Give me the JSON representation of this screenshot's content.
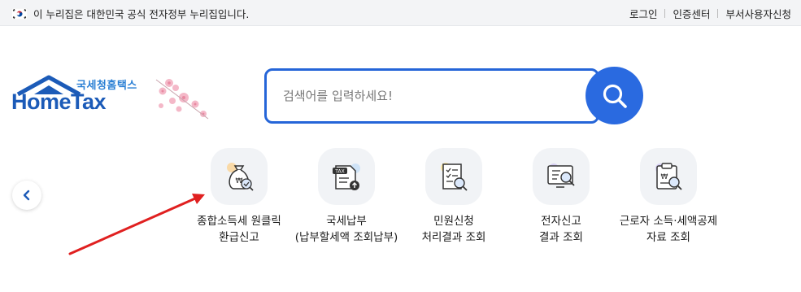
{
  "topbar": {
    "gov_notice": "이 누리집은 대한민국 공식 전자정부 누리집입니다.",
    "links": [
      "로그인",
      "인증센터",
      "부서사용자신청"
    ]
  },
  "logo": {
    "subtitle": "국세청홈택스",
    "title": "HomeTax"
  },
  "search": {
    "placeholder": "검색어를 입력하세요!"
  },
  "quick_menu": [
    {
      "line1": "종합소득세 원클릭",
      "line2": "환급신고",
      "icon": "money-bag-check-icon"
    },
    {
      "line1": "국세납부",
      "line2": "(납부할세액 조회납부)",
      "icon": "tax-document-upload-icon"
    },
    {
      "line1": "민원신청",
      "line2": "처리결과 조회",
      "icon": "checklist-search-icon"
    },
    {
      "line1": "전자신고",
      "line2": "결과 조회",
      "icon": "monitor-search-icon"
    },
    {
      "line1": "근로자 소득·세액공제",
      "line2": "자료 조회",
      "icon": "clipboard-search-icon"
    }
  ],
  "colors": {
    "brand_blue": "#2565d8",
    "annotation_arrow": "#e02020",
    "topbar_bg": "#f3f4f6"
  }
}
